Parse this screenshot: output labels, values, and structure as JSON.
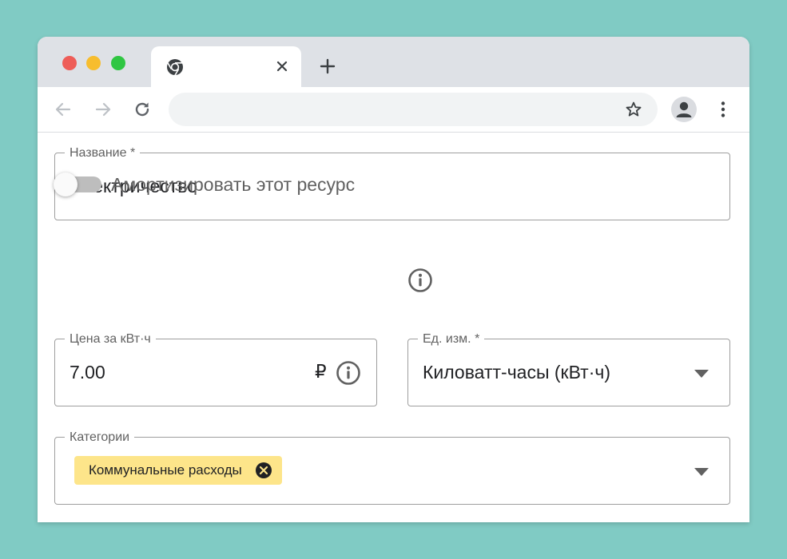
{
  "browser": {
    "tab_close_symbol": "✕",
    "new_tab_symbol": "+",
    "address_bar_value": "",
    "icons": {
      "back": "arrow-left-icon",
      "forward": "arrow-right-icon",
      "reload": "reload-icon",
      "bookmark": "star-icon",
      "profile": "person-icon",
      "menu": "kebab-menu-icon",
      "favicon": "chrome-icon"
    },
    "colors": {
      "close": "#ee5d58",
      "minimize": "#f7bd2e",
      "maximize": "#2fc642"
    }
  },
  "form": {
    "name_field": {
      "label": "Название *",
      "value": "Электричество"
    },
    "amortize_toggle": {
      "label": "Амортизировать этот ресурс",
      "checked": false
    },
    "price_field": {
      "label": "Цена за кВт·ч",
      "value": "7.00",
      "currency": "₽"
    },
    "unit_field": {
      "label": "Ед. изм. *",
      "value": "Киловатт-часы (кВт·ч)"
    },
    "categories_field": {
      "label": "Категории",
      "chips": [
        {
          "label": "Коммунальные расходы"
        }
      ]
    },
    "colors": {
      "chip_background": "#fde58a",
      "toggle_track": "#bdbdbd",
      "border": "#9e9e9e"
    }
  }
}
